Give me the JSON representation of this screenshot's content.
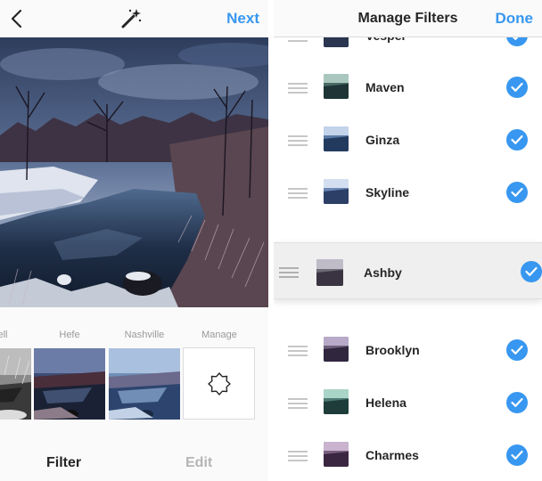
{
  "left": {
    "next_label": "Next",
    "filters": [
      {
        "name": "ell"
      },
      {
        "name": "Hefe"
      },
      {
        "name": "Nashville"
      },
      {
        "name": "Manage"
      }
    ],
    "tabs": {
      "filter": "Filter",
      "edit": "Edit"
    }
  },
  "right": {
    "title": "Manage Filters",
    "done_label": "Done",
    "items": [
      {
        "name": "Vesper"
      },
      {
        "name": "Maven"
      },
      {
        "name": "Ginza"
      },
      {
        "name": "Skyline"
      }
    ],
    "dragging": {
      "name": "Ashby"
    },
    "items_below": [
      {
        "name": "Brooklyn"
      },
      {
        "name": "Helena"
      },
      {
        "name": "Charmes"
      }
    ]
  },
  "colors": {
    "accent": "#3897f0",
    "inactive_tab": "#b5b5b5",
    "text": "#262626"
  },
  "icons": {
    "back": "chevron-left-icon",
    "wand": "magic-wand-icon",
    "manage": "gear-icon",
    "check": "checkmark-icon",
    "handle": "drag-handle-icon"
  }
}
